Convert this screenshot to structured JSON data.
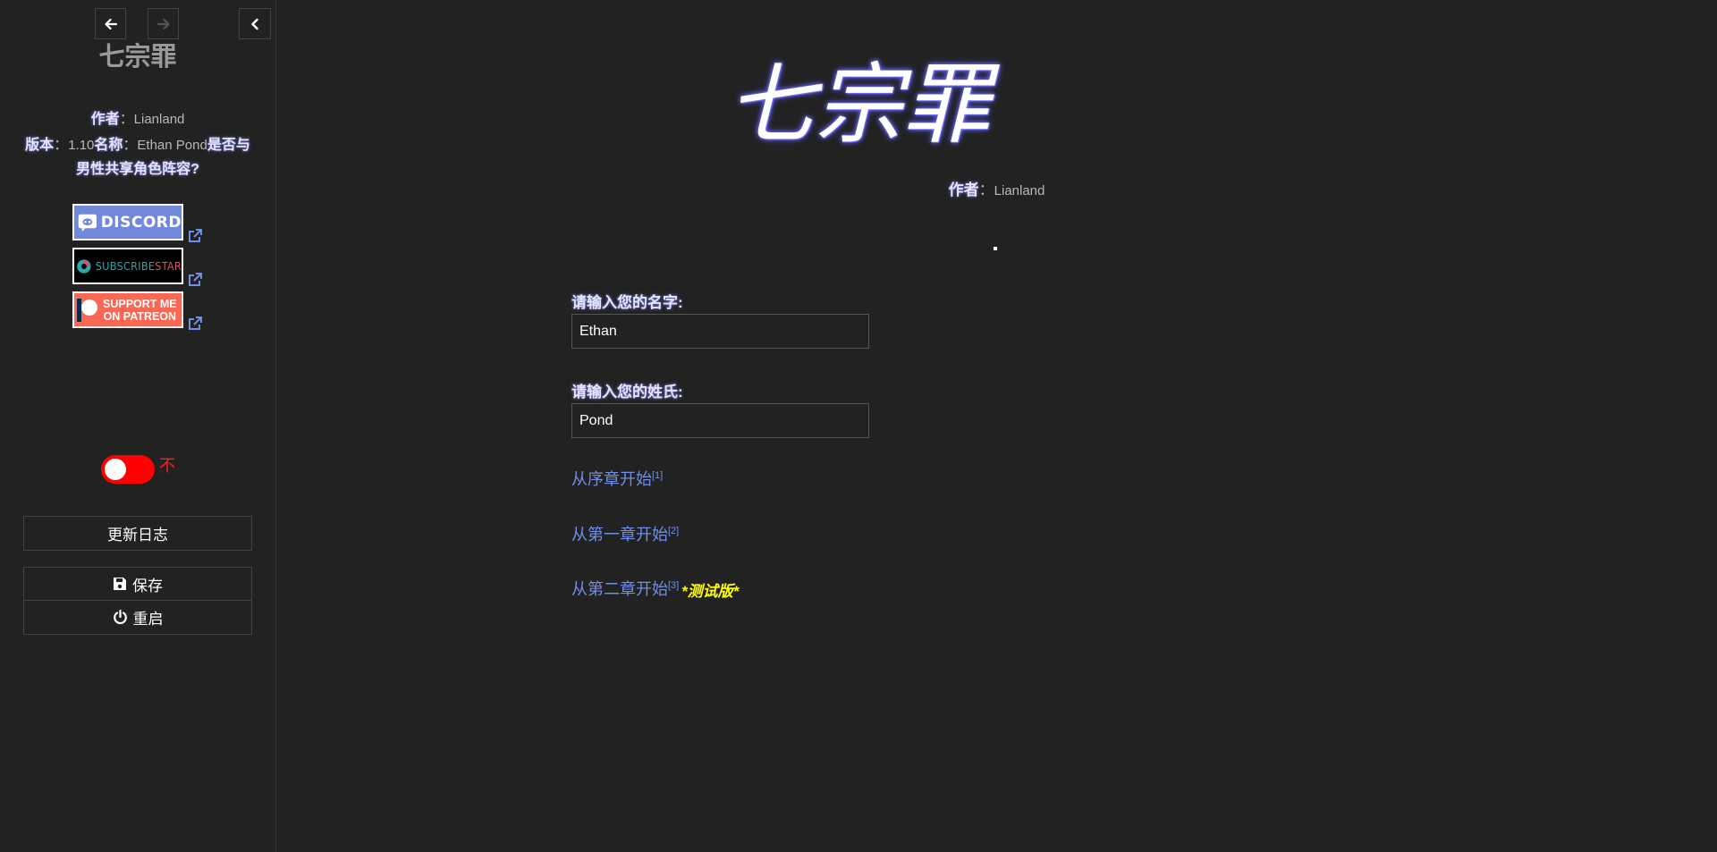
{
  "sidebar": {
    "title": "七宗罪",
    "author_label": "作者",
    "author_sep": "：",
    "author_name": "Lianland",
    "version_label": "版本",
    "version_sep": "：",
    "version_value": "1.10",
    "name_label": "名称",
    "name_sep": "：",
    "name_value": "Ethan Pond",
    "question": "是否与男性共享角色阵容?",
    "badges": {
      "discord": "DISCORD",
      "subscribestar_a": "SUBSCRIBE",
      "subscribestar_b": "STAR",
      "patreon_line1": "SUPPORT ME",
      "patreon_line2": "ON PATREON"
    },
    "toggle_label": "不",
    "toggle_on": false,
    "changelog_label": "更新日志",
    "save_label": "保存",
    "restart_label": "重启",
    "icons": {
      "back": "arrow-left-icon",
      "forward": "arrow-right-icon",
      "collapse": "chevron-left-icon",
      "external": "external-link-icon",
      "save": "floppy-disk-icon",
      "restart": "power-icon"
    }
  },
  "main": {
    "title": "七宗罪",
    "author_label": "作者",
    "author_sep": "：",
    "author_name": "Lianland",
    "first_name_label": "请输入您的名字:",
    "first_name_value": "Ethan",
    "last_name_label": "请输入您的姓氏:",
    "last_name_value": "Pond",
    "links": [
      {
        "label": "从序章开始",
        "note": "[1]"
      },
      {
        "label": "从第一章开始",
        "note": "[2]"
      },
      {
        "label": "从第二章开始",
        "note": "[3]"
      }
    ],
    "beta_tag": "*测试版*"
  },
  "colors": {
    "background": "#222222",
    "link": "#6f8fe8",
    "toggle_off": "#ff0000",
    "beta": "#ffff00",
    "label_glow": "#8a8aff"
  }
}
